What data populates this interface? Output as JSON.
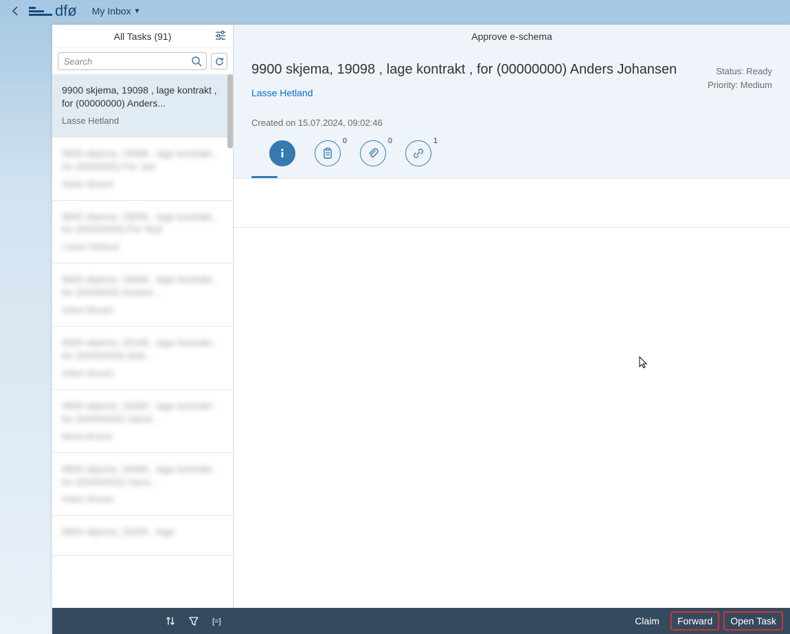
{
  "shell": {
    "logo_text": "dfø",
    "nav_label": "My Inbox"
  },
  "master": {
    "title": "All Tasks (91)",
    "search_placeholder": "Search"
  },
  "tasks": [
    {
      "title": "9900 skjema, 19098 , lage kontrakt , for (00000000) Anders...",
      "sender": "Lasse Hetland",
      "selected": true,
      "blurred": false
    },
    {
      "title": "9900 skjema, 19088 , lage kontrakt , for (0000000) Per Jan",
      "sender": "Adam Bryant",
      "selected": false,
      "blurred": true
    },
    {
      "title": "9900 skjema, 19094 , lage kontrakt , for (00000000) Per Ryd",
      "sender": "Lasse Hetland",
      "selected": false,
      "blurred": true
    },
    {
      "title": "9900 skjema, 18696 , lage kontrakt , for (0000000) Norken...",
      "sender": "Adam Bryant",
      "selected": false,
      "blurred": true
    },
    {
      "title": "9900 skjema, 18199 , lage kontrakt , for (00000000) Abd...",
      "sender": "Adam Bryant",
      "selected": false,
      "blurred": true
    },
    {
      "title": "9900 skjema, 18460 , lage kontrakt , for (00000000) Særd...",
      "sender": "Maria Bryant",
      "selected": false,
      "blurred": true
    },
    {
      "title": "9900 skjema, 18460 , lage kontrakt , for (00000000) Hans...",
      "sender": "Adam Bryant",
      "selected": false,
      "blurred": true
    },
    {
      "title": "9900 skjema, 18455 , lage",
      "sender": "",
      "selected": false,
      "blurred": true
    }
  ],
  "detail": {
    "header": "Approve e-schema",
    "title": "9900 skjema, 19098 , lage kontrakt , for (00000000) Anders Johansen",
    "sender_link": "Lasse Hetland",
    "status_label": "Status: Ready",
    "priority_label": "Priority: Medium",
    "created_label": "Created on 15.07.2024, 09:02:46",
    "tabs": {
      "notes_badge": "0",
      "attachments_badge": "0",
      "links_badge": "1"
    }
  },
  "footer": {
    "claim": "Claim",
    "forward": "Forward",
    "open_task": "Open Task"
  }
}
